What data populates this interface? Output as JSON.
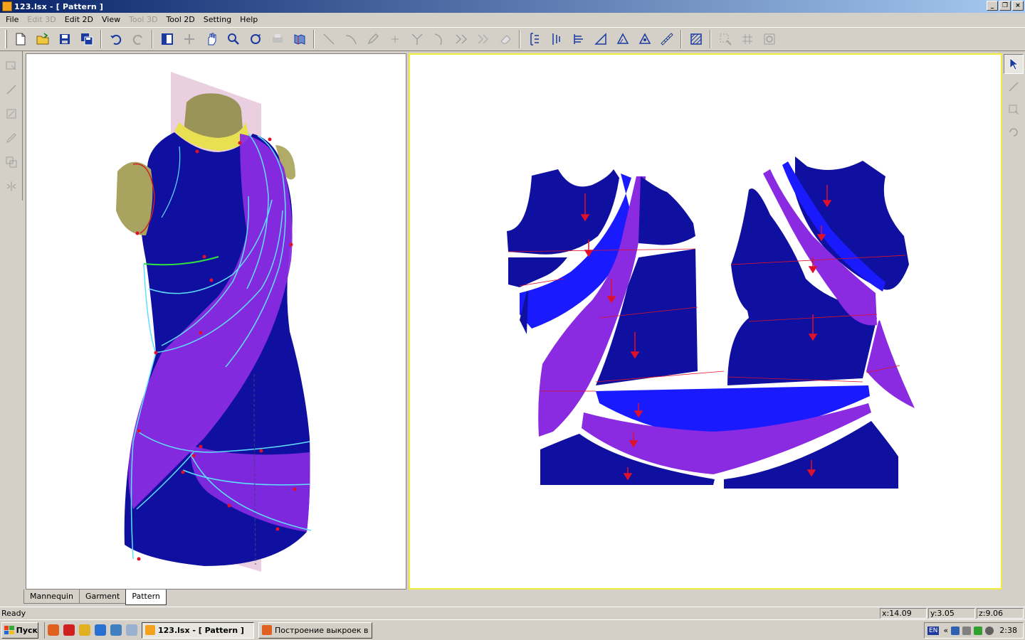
{
  "window": {
    "title": "123.lsx - [ Pattern ]",
    "controls": [
      "_",
      "❐",
      "×"
    ]
  },
  "menu": [
    {
      "label": "File",
      "enabled": true
    },
    {
      "label": "Edit 3D",
      "enabled": false
    },
    {
      "label": "Edit 2D",
      "enabled": true
    },
    {
      "label": "View",
      "enabled": true
    },
    {
      "label": "Tool 3D",
      "enabled": false
    },
    {
      "label": "Tool 2D",
      "enabled": true
    },
    {
      "label": "Setting",
      "enabled": true
    },
    {
      "label": "Help",
      "enabled": true
    }
  ],
  "toolbar_icons": [
    "new-file-icon",
    "open-folder-icon",
    "save-icon",
    "save-all-icon",
    "undo-icon",
    "redo-icon",
    "layout-icon",
    "rotate-icon",
    "pan-hand-icon",
    "zoom-icon",
    "fit-view-icon",
    "print-icon",
    "map-icon",
    "line-tool-icon",
    "curve-tool-icon",
    "pencil-icon",
    "point-icon",
    "split-icon",
    "bend-icon",
    "join-icon",
    "merge-icon",
    "eraser-icon",
    "measure-vertical-icon",
    "measure-horizontal-icon",
    "grade-icon",
    "angle-icon",
    "triangle-icon",
    "triangle-alt-icon",
    "ruler-icon",
    "hatch-icon",
    "select-area-icon",
    "grid-icon",
    "refresh-icon"
  ],
  "tabs": [
    {
      "label": "Mannequin",
      "active": false
    },
    {
      "label": "Garment",
      "active": false
    },
    {
      "label": "Pattern",
      "active": true
    }
  ],
  "status": {
    "text": "Ready",
    "x": "x:14.09",
    "y": "y:3.05",
    "z": "z:9.06"
  },
  "taskbar": {
    "start_label": "Пуск",
    "tasks": [
      {
        "label": "123.lsx - [ Pattern ]",
        "pressed": true
      },
      {
        "label": "Построение выкроек в ...",
        "pressed": false
      }
    ],
    "lang": "EN",
    "chevron": "«",
    "clock": "2:38"
  },
  "colors": {
    "navy": "#1010a0",
    "blue": "#1a1aff",
    "violet": "#8a2be2",
    "mannequin_neck": "#e8e050",
    "seam": "#5ee0ff",
    "arrow": "#e0102a",
    "selection_border": "#f0ec3a"
  }
}
